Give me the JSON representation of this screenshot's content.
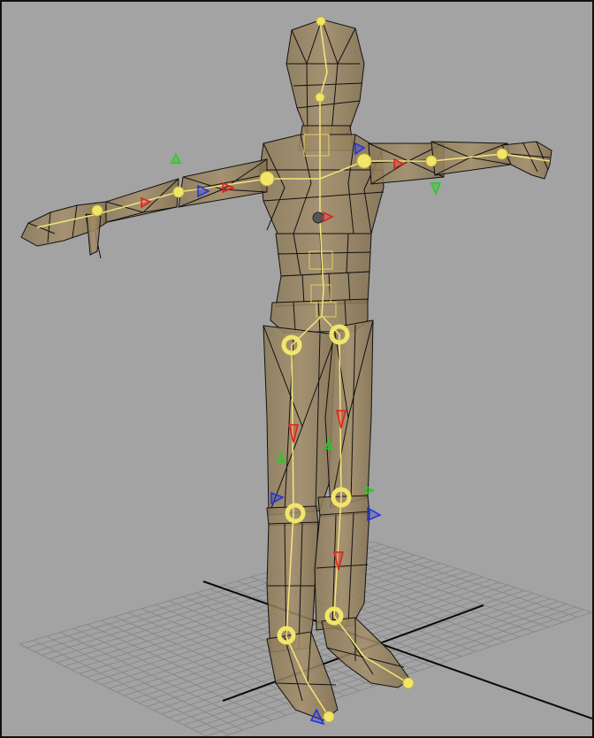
{
  "viewport": {
    "background": "#a3a3a3",
    "grid_color": "#8a8a8a",
    "axis_color": "#0a0a0a"
  },
  "model": {
    "fill": "#9a8663",
    "edge": "#111111",
    "joint_color": "#f1e66a",
    "bone_color": "#f6e57a"
  },
  "manipulators": {
    "x_axis_color": "#e02020",
    "y_axis_color": "#20d020",
    "z_axis_color": "#2030e0"
  }
}
